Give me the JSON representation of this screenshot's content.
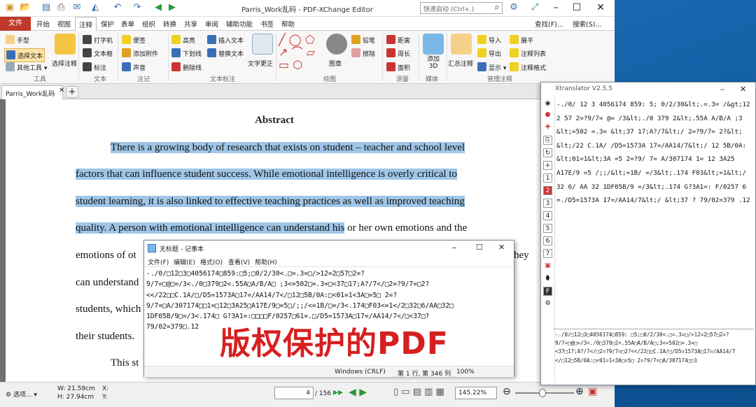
{
  "app": {
    "title": "Parris_Work乱码 - PDF-XChange Editor",
    "quick_search": "快速启动 (Ctrl+.)",
    "find_label": "查找(F)...",
    "search_label": "搜索(S)..."
  },
  "menu": {
    "file": "文件",
    "items": [
      "开始",
      "视图",
      "注释",
      "保护",
      "表单",
      "组织",
      "转换",
      "共享",
      "审阅",
      "辅助功能",
      "书签",
      "帮助"
    ]
  },
  "ribbon": {
    "tools": {
      "hand": "手型",
      "select_text": "选择文本",
      "other_tools": "其他工具",
      "select_annot": "选择注释",
      "group": "工具"
    },
    "text": {
      "typewriter": "打字机",
      "textbox": "文本框",
      "callout": "标注",
      "group": "文本"
    },
    "note": {
      "sticky": "便签",
      "attach": "添加附件",
      "sound": "声音",
      "group": "注记"
    },
    "markup": {
      "highlight": "高亮",
      "underline": "下划线",
      "strike": "删除线",
      "insert_text": "插入文本",
      "replace_text": "替换文本",
      "text_correct": "文字更正",
      "group": "文本标注"
    },
    "drawing": {
      "stamp": "图章",
      "pencil": "铅笔",
      "eraser": "擦除",
      "group": "绘图"
    },
    "measure": {
      "distance": "距离",
      "perimeter": "周长",
      "area": "面积",
      "group": "测量"
    },
    "media": {
      "add3d": "添加 3D",
      "group": "媒体"
    },
    "manage": {
      "summary": "汇总注释",
      "import": "导入",
      "export": "导出",
      "show": "显示",
      "flatten": "展平",
      "list": "注释列表",
      "style": "注释格式",
      "group": "管理注释"
    }
  },
  "doc_tab": "Parris_Work乱码",
  "document": {
    "heading": "Abstract",
    "lines": [
      {
        "hl": "There is a growing body of research that exists on student – teacher and school level",
        "rest": ""
      },
      {
        "hl": "factors that can influence student success. While emotional intelligence is overly critical to",
        "rest": ""
      },
      {
        "hl": "student learning, it is also linked to effective teaching practices as well as improved teaching",
        "rest": ""
      },
      {
        "hl": "quality. A person with emotional intelligence can understand his",
        "rest": " or her own emotions and the"
      },
      {
        "hl": "",
        "rest": "emotions of ot"
      },
      {
        "hl": "",
        "rest": "can understand"
      },
      {
        "hl": "",
        "rest": "students, which"
      },
      {
        "hl": "",
        "rest": "their students."
      },
      {
        "hl": "",
        "rest": "This st"
      }
    ],
    "right_fragment": "hey"
  },
  "status": {
    "options": "选项...",
    "w": "W: 21.59cm",
    "h": "H: 27.94cm",
    "x": "X:",
    "y": "Y:",
    "page": "4",
    "page_total": "/ 156",
    "zoom": "145.22%"
  },
  "notepad": {
    "title": "无标题 - 记事本",
    "menu": [
      "文件(F)",
      "编辑(E)",
      "格式(O)",
      "查看(V)",
      "帮助(H)"
    ],
    "lines": [
      "-./0/□12□3□4056174□859:□5;□0/2/30<.□=.3=□/>12=2□57□2=?",
      "9/7=□@□=/3<./0□379□2<.55A□A/B/A□ ;3<=502□=.3=□<37□17;A?/7</□2=?9/7=□2?",
      "<</22□□C.1A/□/D5=1573A□17=/AA14/7</□12□5B/0A:□<01=1<3A□=5□ 2=?",
      "9/7=□A/307174□□1=□12□3A25□A17E/9□=5□/;;/<=1B/□=/3<.174□F03<=1</2□32□6/AA□32□",
      "1DF05B/9□=/3<.174□ G?3A1=:□□□□F/0257□61=.□/D5=1573A□17=/AA14/7</□<37□?",
      "79/02=379□.12"
    ],
    "status_enc": "Windows (CRLF)",
    "status_pos": "第 1 行, 第 346 列",
    "status_zoom": "100%"
  },
  "watermark": "版权保护的PDF",
  "xtranslator": {
    "title": "Xtranslator V2.5.5",
    "lines": [
      "-./0/ 12 3 4056174 859: 5; 0/2/30&lt;.=.3= /&gt;12",
      "2 57 2=?9/7= @= /3&lt;./0 379 2&lt;.55A A/B/A ;3",
      "&lt;=502 =.3= &lt;37 17;A?/7&lt;/ 2=?9/7= 2?&lt;",
      "&lt;/22 C.1A/ /D5=1573A 17=/AA14/7&lt;/ 12 5B/0A:",
      "&lt;01=1&lt;3A =5 2=?9/ 7= A/307174 1= 12 3A25",
      "A17E/9 =5 /;;/&lt;=1B/ =/3&lt;.174 F03&lt;=1&lt;/",
      "32 6/ AA 32 1DF05B/9 =/3&lt;.174 G?3A1=: F/0257 6",
      "=./D5=1573A 17=/AA14/7&lt;/ &lt;37 ? 79/02=379 .12"
    ],
    "bottom_lines": [
      "-./0/□12□3□4056174□859: □5;□0/2/30<.□=.3=□/>12=2□57□2=?",
      "9/7=□@□=/3<./0□379□2<.55A□A/B/A□;3<=502□=.3=□",
      "<37□17;A?/7</□2=?9/7=□2?<</22□□C.1A/□/D5=1573A□17=/AA14/7",
      "</□12□5B/0A:□<01=1<3A□=5□ 2=?9/7=□A/307174□□1"
    ]
  }
}
